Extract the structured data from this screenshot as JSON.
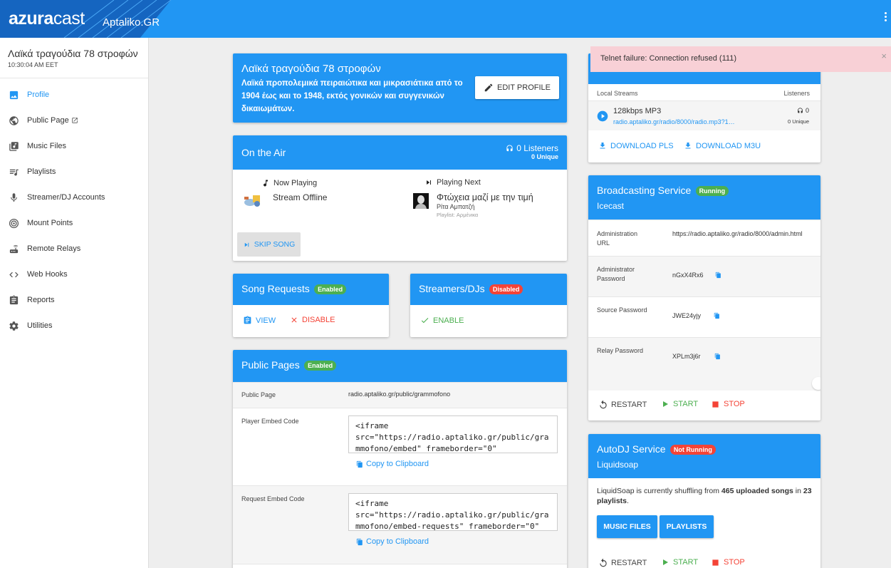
{
  "app": {
    "logo_bold": "azura",
    "logo_light": "cast",
    "station_short": "Aptaliko.GR"
  },
  "sidebar": {
    "station_name": "Λαϊκά τραγούδια 78 στροφών",
    "time": "10:30:04 AM EET",
    "items": [
      {
        "label": "Profile",
        "icon": "image-icon"
      },
      {
        "label": "Public Page",
        "icon": "globe-icon"
      },
      {
        "label": "Music Files",
        "icon": "music-library-icon"
      },
      {
        "label": "Playlists",
        "icon": "playlist-icon"
      },
      {
        "label": "Streamer/DJ Accounts",
        "icon": "microphone-icon"
      },
      {
        "label": "Mount Points",
        "icon": "broadcast-icon"
      },
      {
        "label": "Remote Relays",
        "icon": "router-icon"
      },
      {
        "label": "Web Hooks",
        "icon": "code-icon"
      },
      {
        "label": "Reports",
        "icon": "clipboard-icon"
      },
      {
        "label": "Utilities",
        "icon": "gear-icon"
      }
    ]
  },
  "profile": {
    "title": "Λαϊκά τραγούδια 78 στροφών",
    "description": "Λαϊκά προπολεμικά πειραιώτικα και μικρασιάτικα από το 1904 έως και το 1948, εκτός γονικών και συγγενικών δικαιωμάτων.",
    "edit_label": "EDIT PROFILE"
  },
  "on_air": {
    "title": "On the Air",
    "listeners": "0 Listeners",
    "unique": "0 Unique",
    "now_playing_label": "Now Playing",
    "now_playing_text": "Stream Offline",
    "playing_next_label": "Playing Next",
    "next_title": "Φτώχεια μαζί με την τιμή",
    "next_artist": "Ρίτα Αμπατζή",
    "next_playlist": "Playlist: Αρμένικα",
    "skip_label": "SKIP SONG"
  },
  "song_requests": {
    "title": "Song Requests",
    "badge": "Enabled",
    "view_label": "VIEW",
    "disable_label": "DISABLE"
  },
  "streamers": {
    "title": "Streamers/DJs",
    "badge": "Disabled",
    "enable_label": "ENABLE"
  },
  "public_pages": {
    "title": "Public Pages",
    "badge": "Enabled",
    "public_page_label": "Public Page",
    "public_page_url": "radio.aptaliko.gr/public/grammofono",
    "player_embed_label": "Player Embed Code",
    "player_embed_code": "<iframe\nsrc=\"https://radio.aptaliko.gr/public/grammofono/embed\" frameborder=\"0\"",
    "request_embed_label": "Request Embed Code",
    "request_embed_code": "<iframe\nsrc=\"https://radio.aptaliko.gr/public/grammofono/embed-requests\" frameborder=\"0\"",
    "copy_label": "Copy to Clipboard"
  },
  "alert": {
    "message": "Telnet failure: Connection refused (111)",
    "close": "×"
  },
  "streams": {
    "col_local": "Local Streams",
    "col_listeners": "Listeners",
    "name": "128kbps MP3",
    "url": "radio.aptaliko.gr/radio/8000/radio.mp3?1…",
    "count": "0",
    "unique": "0 Unique",
    "download_pls": "DOWNLOAD PLS",
    "download_m3u": "DOWNLOAD M3U"
  },
  "broadcasting": {
    "title": "Broadcasting Service",
    "badge": "Running",
    "subtitle": "Icecast",
    "rows": [
      {
        "label": "Administration URL",
        "value": "https://radio.aptaliko.gr/radio/8000/admin.html"
      },
      {
        "label": "Administrator Password",
        "value": "nGxX4Rx6"
      },
      {
        "label": "Source Password",
        "value": "JWE24yjy"
      },
      {
        "label": "Relay Password",
        "value": "XPLm3j6r"
      }
    ],
    "restart": "RESTART",
    "start": "START",
    "stop": "STOP"
  },
  "autodj": {
    "title": "AutoDJ Service",
    "badge": "Not Running",
    "subtitle": "Liquidsoap",
    "text_pre": "LiquidSoap is currently shuffling from ",
    "songs": "465 uploaded songs",
    "text_mid": " in ",
    "playlists": "23 playlists",
    "text_post": ".",
    "music_files_btn": "MUSIC FILES",
    "playlists_btn": "PLAYLISTS",
    "restart": "RESTART",
    "start": "START",
    "stop": "STOP"
  },
  "colors": {
    "primary": "#2196f3",
    "success": "#4caf50",
    "danger": "#f44336",
    "alert_bg": "#f8d0d6"
  }
}
